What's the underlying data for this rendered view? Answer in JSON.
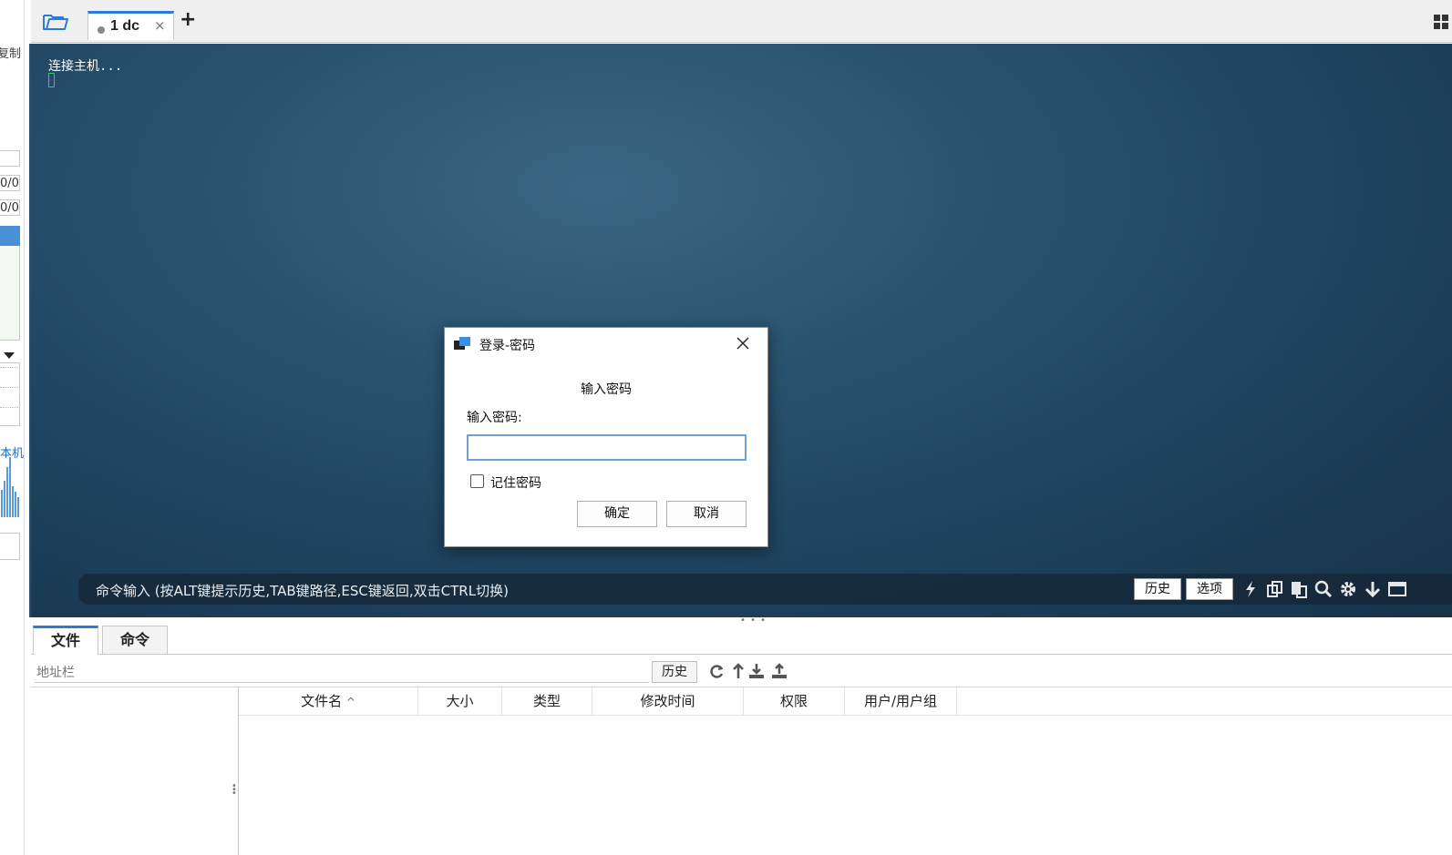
{
  "left_panel": {
    "copy_text": "复制",
    "field_1": "0/0",
    "field_2": "0/0",
    "host_label": "本机"
  },
  "tabs": [
    {
      "label": "1 dc",
      "close": "×"
    }
  ],
  "new_tab": "+",
  "terminal": {
    "output_line": "连接主机..."
  },
  "command_bar": {
    "placeholder": "命令输入 (按ALT键提示历史,TAB键路径,ESC键返回,双击CTRL切换)",
    "history_button": "历史",
    "options_button": "选项"
  },
  "dialog": {
    "title": "登录-密码",
    "heading": "输入密码",
    "field_label": "输入密码:",
    "password_value": "",
    "remember_label": "记住密码",
    "remember_checked": false,
    "ok_button": "确定",
    "cancel_button": "取消"
  },
  "bottom_panel": {
    "tabs": [
      "文件",
      "命令"
    ],
    "address_placeholder": "地址栏",
    "history_button": "历史",
    "columns": [
      "文件名",
      "大小",
      "类型",
      "修改时间",
      "权限",
      "用户/用户组"
    ],
    "sort_indicator": "^"
  },
  "colors": {
    "accent": "#2b7bd6",
    "terminal_bg": "#1f4460",
    "cursor": "#2ecc71"
  }
}
